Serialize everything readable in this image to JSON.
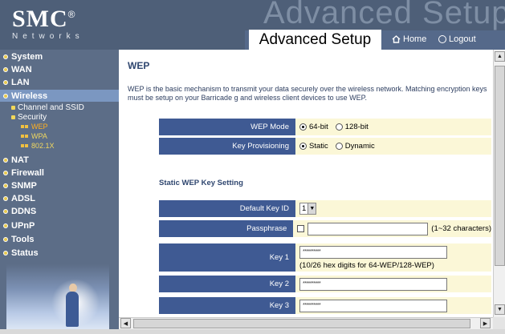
{
  "header": {
    "logo": "SMC",
    "logo_mark": "®",
    "logo_sub": "Networks",
    "watermark": "Advanced Setup",
    "title": "Advanced Setup",
    "home_label": "Home",
    "logout_label": "Logout"
  },
  "sidebar": {
    "items": [
      {
        "label": "System"
      },
      {
        "label": "WAN"
      },
      {
        "label": "LAN"
      },
      {
        "label": "Wireless"
      },
      {
        "label": "NAT"
      },
      {
        "label": "Firewall"
      },
      {
        "label": "SNMP"
      },
      {
        "label": "ADSL"
      },
      {
        "label": "DDNS"
      },
      {
        "label": "UPnP"
      },
      {
        "label": "Tools"
      },
      {
        "label": "Status"
      }
    ],
    "wireless_sub": [
      {
        "label": "Channel and SSID"
      },
      {
        "label": "Security"
      }
    ],
    "security_sub": [
      {
        "label": "WEP"
      },
      {
        "label": "WPA"
      },
      {
        "label": "802.1X"
      }
    ]
  },
  "main": {
    "title": "WEP",
    "description": "WEP is the basic mechanism to transmit your data securely over the wireless network. Matching encryption keys must be setup on your Barricade g and wireless client devices to use WEP.",
    "wep_mode": {
      "label": "WEP Mode",
      "options": [
        "64-bit",
        "128-bit"
      ],
      "selected": "64-bit"
    },
    "key_provisioning": {
      "label": "Key Provisioning",
      "options": [
        "Static",
        "Dynamic"
      ],
      "selected": "Static"
    },
    "section_heading": "Static WEP Key Setting",
    "default_key_id": {
      "label": "Default Key ID",
      "value": "1"
    },
    "passphrase": {
      "label": "Passphrase",
      "value": "",
      "hint": "(1~32 characters)"
    },
    "key1": {
      "label": "Key 1",
      "value": "**********",
      "hint": "(10/26 hex digits for 64-WEP/128-WEP)"
    },
    "key2": {
      "label": "Key 2",
      "value": "**********"
    },
    "key3": {
      "label": "Key 3",
      "value": "**********"
    }
  },
  "colors": {
    "header_bg": "#4e5f78",
    "sidebar_bg": "#5c6d87",
    "label_bg": "#3f5a93",
    "value_bg": "#fbf7d7",
    "title_color": "#2f466f"
  }
}
